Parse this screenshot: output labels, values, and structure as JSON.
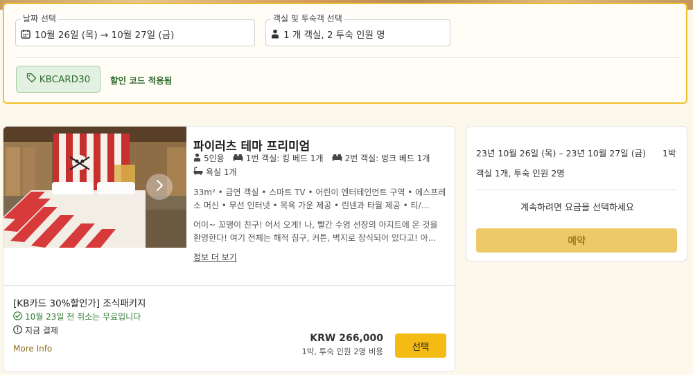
{
  "search": {
    "date_label": "날짜 선택",
    "date_value": "10월 26일 (목) → 10월 27일 (금)",
    "guests_label": "객실 및 투숙객 선택",
    "guests_value": "1 개 객실, 2 투숙 인원 명",
    "promo_code": "KBCARD30",
    "promo_status": "할인 코드 적용됨"
  },
  "room": {
    "title": "파이러츠 테마 프리미엄",
    "occupancy": "5인용",
    "bed1": "1번 객실: 킹 베드 1개",
    "bed2": "2번 객실: 벙크 베드 1개",
    "bath": "욕실 1개",
    "features": "33m² • 금연 객실 • 스마트 TV • 어린이 엔터테인먼트 구역 • 에스프레소 머신 • 무선 인터넷 • 목욕 가운 제공 • 린넨과 타월 제공 • 티/...",
    "description": "어이~ 꼬맹이 친구! 어서 오게! 나, 빨간 수염 선장의 아지트에 온 것을 환영한다! 여기 전체는 해적 침구, 커튼, 벽지로 장식되어 있다고! 아...",
    "more_label": "정보 더 보기"
  },
  "rate": {
    "package_name": "[KB카드 30%할인가] 조식패키지",
    "cancel_note": "10월 23일 전 취소는 무료입니다",
    "pay_note": "지금 결제",
    "more_info": "More Info",
    "price": "KRW 266,000",
    "price_note": "1박, 투숙 인원 2명 비용",
    "select_label": "선택"
  },
  "summary": {
    "dates": "23년 10월 26일 (목) – 23년 10월 27일 (금)",
    "nights": "1박",
    "guests": "객실 1개, 투숙 인원 2명",
    "prompt": "계속하려면 요금을 선택하세요",
    "book_label": "예약"
  },
  "colors": {
    "accent": "#f4bb15",
    "promo_green": "#2e6b2e",
    "book_disabled": "#edc96a"
  }
}
